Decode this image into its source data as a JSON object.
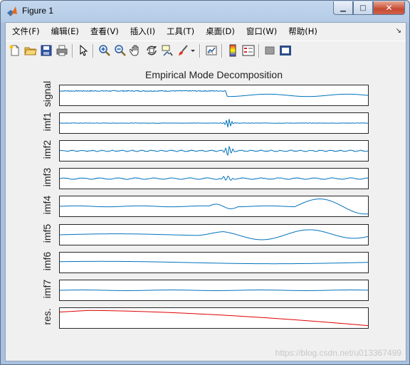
{
  "window": {
    "title": "Figure 1",
    "buttons": {
      "minimize": "▁",
      "maximize": "□",
      "close": "✕"
    }
  },
  "menubar": {
    "items": [
      "文件(F)",
      "编辑(E)",
      "查看(V)",
      "插入(I)",
      "工具(T)",
      "桌面(D)",
      "窗口(W)",
      "帮助(H)"
    ],
    "dock_arrow": "↘"
  },
  "toolbar": {
    "icons": [
      "new-figure-icon",
      "open-file-icon",
      "save-icon",
      "print-icon",
      "pointer-icon",
      "zoom-in-icon",
      "zoom-out-icon",
      "pan-hand-icon",
      "rotate-3d-icon",
      "data-cursor-icon",
      "brush-icon",
      "brush-dropdown-icon",
      "link-plot-icon",
      "colorbar-icon",
      "legend-icon",
      "hide-plot-tools-icon",
      "show-plot-tools-icon"
    ]
  },
  "figure": {
    "title": "Empirical Mode Decomposition",
    "subplots": [
      "signal",
      "imf1",
      "imf2",
      "imf3",
      "imf4",
      "imf5",
      "imf6",
      "imf7",
      "res."
    ],
    "line_color": "#0072bd",
    "residual_color": "#e00000"
  },
  "watermark": "https://blog.csdn.net/u013367499"
}
